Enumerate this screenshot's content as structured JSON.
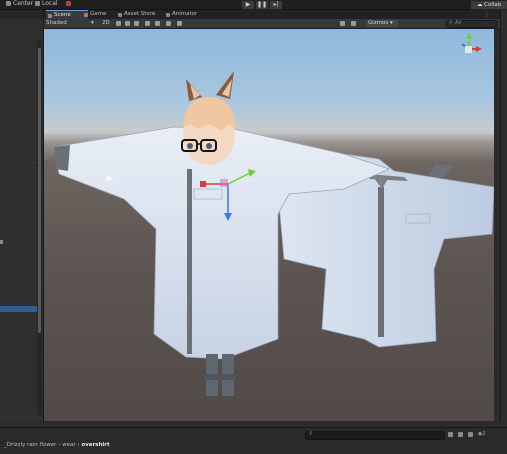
{
  "toolbar": {
    "center_label": "Center",
    "local_label": "Local",
    "collab_label": "Collab",
    "play_icon": "play-icon",
    "pause_icon": "pause-icon",
    "step_icon": "step-icon"
  },
  "tabs": [
    {
      "label": "Scene",
      "icon": "scene-icon",
      "active": true
    },
    {
      "label": "Game",
      "icon": "game-icon",
      "active": false
    },
    {
      "label": "Asset Store",
      "icon": "asset-store-icon",
      "active": false
    },
    {
      "label": "Animator",
      "icon": "animator-icon",
      "active": false
    }
  ],
  "scenebar": {
    "shading_mode": "Shaded",
    "mode_2d": "2D",
    "gizmos_label": "Gizmos",
    "search_prefix": "All"
  },
  "breadcrumb": {
    "items": [
      "_Drizzly rain flower",
      "wear"
    ],
    "current": "overshirt",
    "separator": "›"
  },
  "bottom": {
    "badge_count": "2"
  },
  "colors": {
    "accent": "#2f5d94",
    "tab_highlight": "#6a9fd8",
    "gizmo_x": "#d93b3b",
    "gizmo_y": "#6ad13a",
    "gizmo_z": "#3b7be0",
    "shirt": "#dfe7f2",
    "plaid": "#6c7078"
  }
}
